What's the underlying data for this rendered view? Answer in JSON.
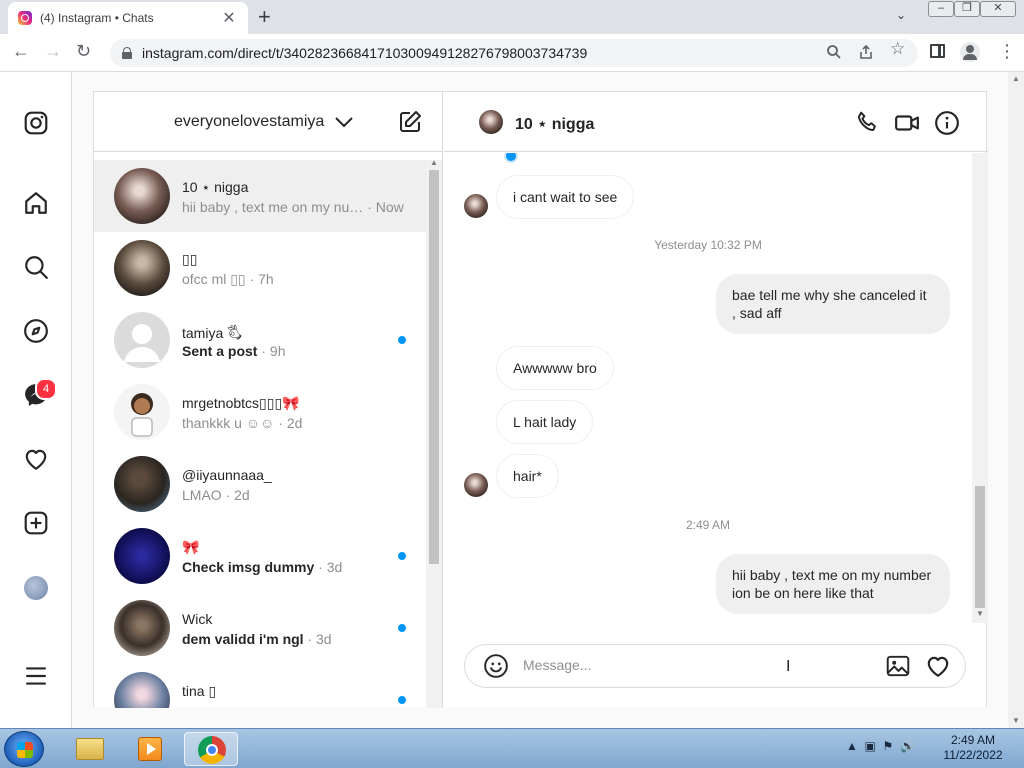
{
  "browser": {
    "tab_title": "(4) Instagram • Chats",
    "tab_close": "✕",
    "new_tab": "+",
    "url": "instagram.com/direct/t/340282366841710300949128276798003734739"
  },
  "nav": {
    "badge_count": "4",
    "icons": [
      "instagram-icon",
      "home-icon",
      "search-icon",
      "explore-icon",
      "messenger-icon",
      "heart-icon",
      "create-icon",
      "avatar",
      "menu-icon"
    ]
  },
  "inbox": {
    "username": "everyonelovestamiya",
    "threads": [
      {
        "name": "10 ⋆ nigga",
        "preview": "hii baby , text me on my nu…",
        "time": " · Now",
        "unread": false,
        "active": true
      },
      {
        "name": "▯▯",
        "preview": "ofcc ml ▯▯",
        "time": " · 7h",
        "unread": false
      },
      {
        "name": "tamiya 🖏",
        "preview": "Sent a post",
        "time": " · 9h",
        "unread": true
      },
      {
        "name": "mrgetnobtcs▯▯▯🎀",
        "preview": "thankkk u ☺☺",
        "time": " · 2d",
        "unread": false
      },
      {
        "name": "@iiyaunnaaa_",
        "preview": "LMAO",
        "time": " · 2d",
        "unread": false
      },
      {
        "name": "🎀",
        "preview": "Check imsg dummy",
        "time": " · 3d",
        "unread": true
      },
      {
        "name": "Wick",
        "preview": "dem validd i'm ngl",
        "time": " · 3d",
        "unread": true
      },
      {
        "name": "tina ▯",
        "preview": "",
        "time": "",
        "unread": true
      }
    ]
  },
  "conversation": {
    "name": "10 ⋆ nigga",
    "messages": [
      {
        "text": "i cant wait to see",
        "direction": "in"
      },
      {
        "timestamp": "Yesterday 10:32 PM"
      },
      {
        "text": "bae tell me why she canceled it , sad aff",
        "direction": "out"
      },
      {
        "text": "Awwwww bro",
        "direction": "in"
      },
      {
        "text": "L hait lady",
        "direction": "in"
      },
      {
        "text": "hair*",
        "direction": "in"
      },
      {
        "timestamp": "2:49 AM"
      },
      {
        "text": "hii baby , text me on my number ion be on here like that",
        "direction": "out"
      }
    ],
    "composer_placeholder": "Message..."
  },
  "taskbar": {
    "clock_time": "2:49 AM",
    "clock_date": "11/22/2022"
  },
  "colors": {
    "accent": "#0095f6",
    "badge": "#ff3040"
  }
}
